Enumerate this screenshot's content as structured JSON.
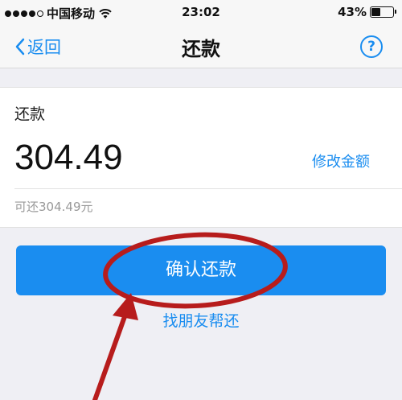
{
  "status_bar": {
    "carrier": "中国移动",
    "time": "23:02",
    "battery_percent": "43%",
    "battery_level": 0.43,
    "signal_icon": "signal-dots-icon",
    "wifi_icon": "wifi-icon"
  },
  "nav": {
    "back_label": "返回",
    "title": "还款",
    "help_label": "?"
  },
  "repay": {
    "label": "还款",
    "amount": "304.49",
    "modify_label": "修改金额",
    "available_text": "可还304.49元"
  },
  "actions": {
    "confirm_label": "确认还款",
    "friend_label": "找朋友帮还"
  },
  "colors": {
    "accent": "#1a8df0",
    "annotation": "#b71c1c"
  }
}
